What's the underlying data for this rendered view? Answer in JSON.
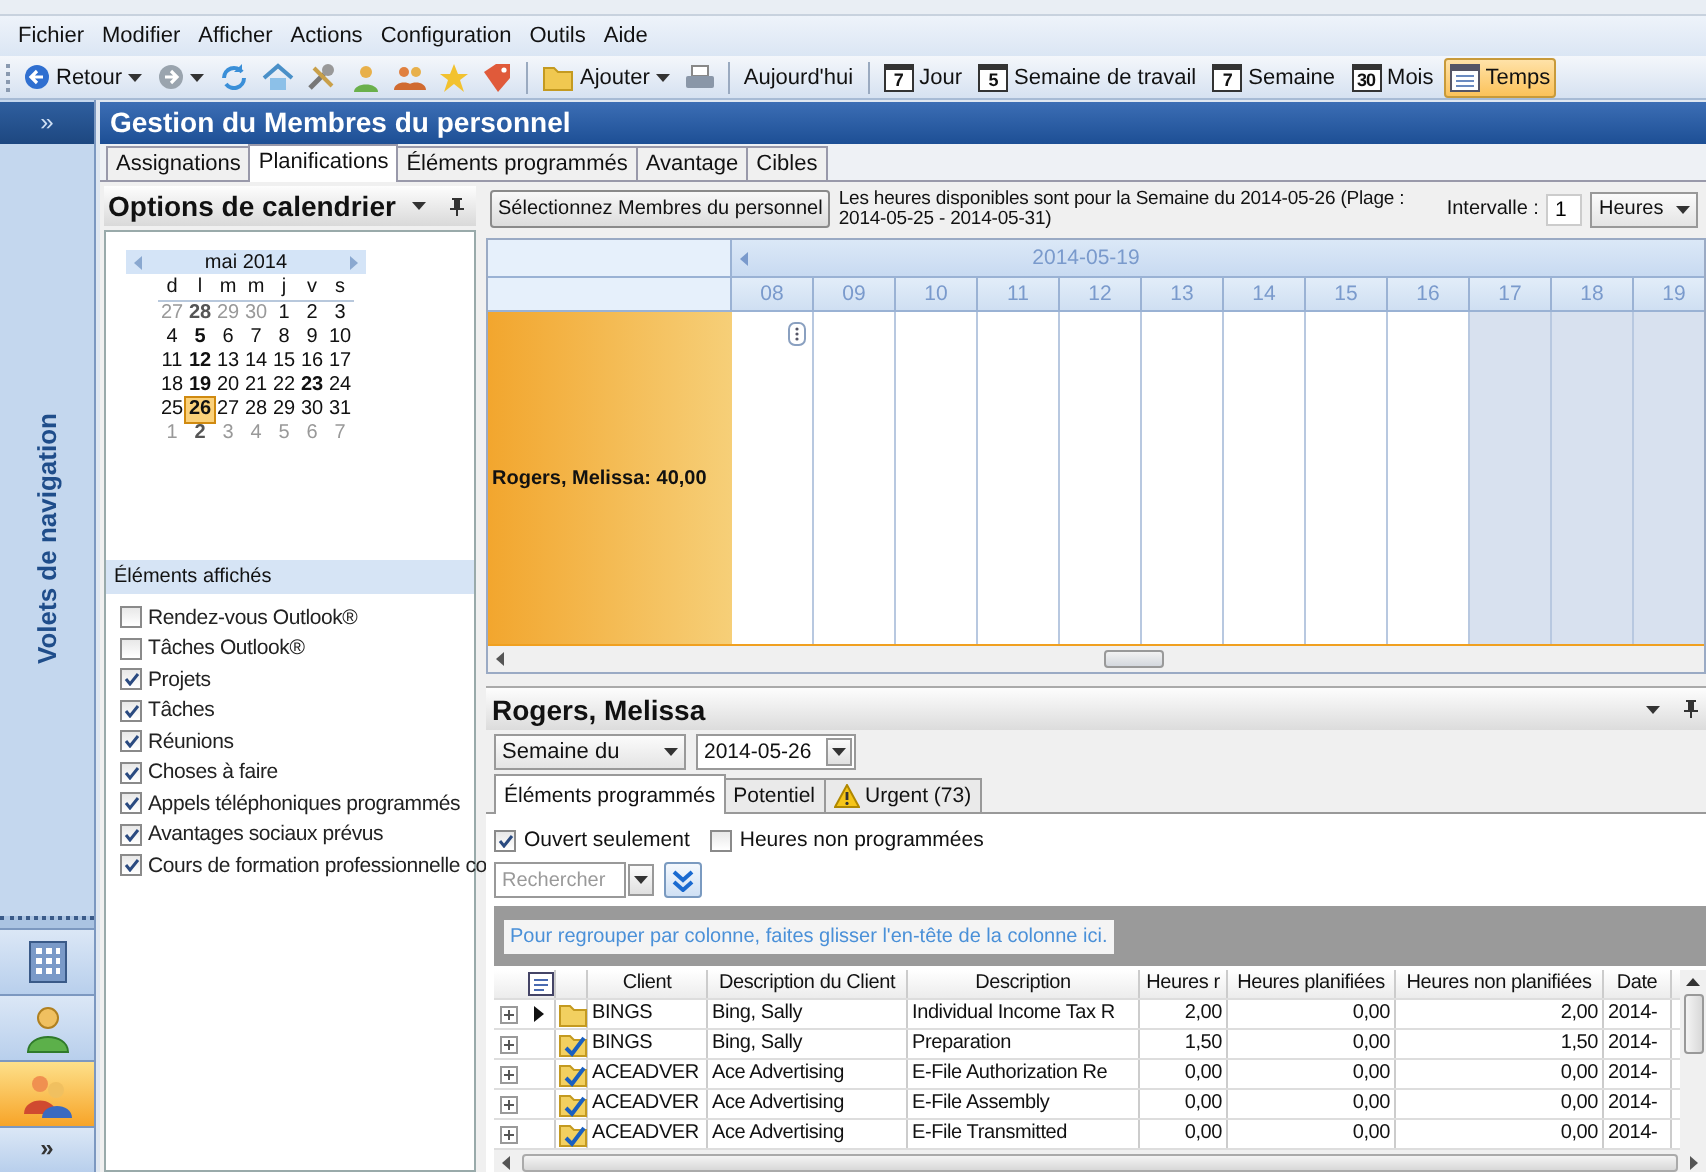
{
  "menu": [
    "Fichier",
    "Modifier",
    "Afficher",
    "Actions",
    "Configuration",
    "Outils",
    "Aide"
  ],
  "toolbar": {
    "back_label": "Retour",
    "add_label": "Ajouter",
    "today_label": "Aujourd'hui",
    "views": [
      {
        "number": "7",
        "label": "Jour",
        "selected": false
      },
      {
        "number": "5",
        "label": "Semaine de travail",
        "selected": false
      },
      {
        "number": "7",
        "label": "Semaine",
        "selected": false
      },
      {
        "number": "30",
        "label": "Mois",
        "selected": false
      },
      {
        "label": "Temps",
        "selected": true
      }
    ]
  },
  "nav": {
    "expand_glyph": "»",
    "title": "Volets de navigation",
    "bottom_glyph": "»",
    "buttons": [
      {
        "selected": false
      },
      {
        "selected": false
      },
      {
        "selected": true
      }
    ]
  },
  "window": {
    "title": "Gestion du Membres du personnel"
  },
  "tabs": [
    {
      "label": "Assignations",
      "selected": false
    },
    {
      "label": "Planifications",
      "selected": true
    },
    {
      "label": "Éléments programmés",
      "selected": false
    },
    {
      "label": "Avantage",
      "selected": false
    },
    {
      "label": "Cibles",
      "selected": false
    }
  ],
  "calendar_options": {
    "title": "Options de calendrier",
    "month": "mai 2014",
    "weekdays": [
      "d",
      "l",
      "m",
      "m",
      "j",
      "v",
      "s"
    ],
    "weeks": [
      [
        {
          "day": "27",
          "other_month": true,
          "bold": false,
          "selected": false
        },
        {
          "day": "28",
          "other_month": true,
          "bold": true,
          "selected": false
        },
        {
          "day": "29",
          "other_month": true,
          "bold": false,
          "selected": false
        },
        {
          "day": "30",
          "other_month": true,
          "bold": false,
          "selected": false
        },
        {
          "day": "1",
          "other_month": false,
          "bold": false,
          "selected": false
        },
        {
          "day": "2",
          "other_month": false,
          "bold": false,
          "selected": false
        },
        {
          "day": "3",
          "other_month": false,
          "bold": false,
          "selected": false
        }
      ],
      [
        {
          "day": "4",
          "other_month": false,
          "bold": false,
          "selected": false
        },
        {
          "day": "5",
          "other_month": false,
          "bold": true,
          "selected": false
        },
        {
          "day": "6",
          "other_month": false,
          "bold": false,
          "selected": false
        },
        {
          "day": "7",
          "other_month": false,
          "bold": false,
          "selected": false
        },
        {
          "day": "8",
          "other_month": false,
          "bold": false,
          "selected": false
        },
        {
          "day": "9",
          "other_month": false,
          "bold": false,
          "selected": false
        },
        {
          "day": "10",
          "other_month": false,
          "bold": false,
          "selected": false
        }
      ],
      [
        {
          "day": "11",
          "other_month": false,
          "bold": false,
          "selected": false
        },
        {
          "day": "12",
          "other_month": false,
          "bold": true,
          "selected": false
        },
        {
          "day": "13",
          "other_month": false,
          "bold": false,
          "selected": false
        },
        {
          "day": "14",
          "other_month": false,
          "bold": false,
          "selected": false
        },
        {
          "day": "15",
          "other_month": false,
          "bold": false,
          "selected": false
        },
        {
          "day": "16",
          "other_month": false,
          "bold": false,
          "selected": false
        },
        {
          "day": "17",
          "other_month": false,
          "bold": false,
          "selected": false
        }
      ],
      [
        {
          "day": "18",
          "other_month": false,
          "bold": false,
          "selected": false
        },
        {
          "day": "19",
          "other_month": false,
          "bold": true,
          "selected": false
        },
        {
          "day": "20",
          "other_month": false,
          "bold": false,
          "selected": false
        },
        {
          "day": "21",
          "other_month": false,
          "bold": false,
          "selected": false
        },
        {
          "day": "22",
          "other_month": false,
          "bold": false,
          "selected": false
        },
        {
          "day": "23",
          "other_month": false,
          "bold": true,
          "selected": false
        },
        {
          "day": "24",
          "other_month": false,
          "bold": false,
          "selected": false
        }
      ],
      [
        {
          "day": "25",
          "other_month": false,
          "bold": false,
          "selected": false
        },
        {
          "day": "26",
          "other_month": false,
          "bold": true,
          "selected": true
        },
        {
          "day": "27",
          "other_month": false,
          "bold": false,
          "selected": false
        },
        {
          "day": "28",
          "other_month": false,
          "bold": false,
          "selected": false
        },
        {
          "day": "29",
          "other_month": false,
          "bold": false,
          "selected": false
        },
        {
          "day": "30",
          "other_month": false,
          "bold": false,
          "selected": false
        },
        {
          "day": "31",
          "other_month": false,
          "bold": false,
          "selected": false
        }
      ],
      [
        {
          "day": "1",
          "other_month": true,
          "bold": false,
          "selected": false
        },
        {
          "day": "2",
          "other_month": true,
          "bold": true,
          "selected": false
        },
        {
          "day": "3",
          "other_month": true,
          "bold": false,
          "selected": false
        },
        {
          "day": "4",
          "other_month": true,
          "bold": false,
          "selected": false
        },
        {
          "day": "5",
          "other_month": true,
          "bold": false,
          "selected": false
        },
        {
          "day": "6",
          "other_month": true,
          "bold": false,
          "selected": false
        },
        {
          "day": "7",
          "other_month": true,
          "bold": false,
          "selected": false
        }
      ]
    ],
    "shown_title": "Éléments affichés",
    "shown_items": [
      {
        "label": "Rendez-vous Outlook®",
        "checked": false
      },
      {
        "label": "Tâches Outlook®",
        "checked": false
      },
      {
        "label": "Projets",
        "checked": true
      },
      {
        "label": "Tâches",
        "checked": true
      },
      {
        "label": "Réunions",
        "checked": true
      },
      {
        "label": "Choses à faire",
        "checked": true
      },
      {
        "label": "Appels téléphoniques programmés",
        "checked": true
      },
      {
        "label": "Avantages sociaux prévus",
        "checked": true
      },
      {
        "label": "Cours de formation professionnelle co",
        "checked": true
      }
    ]
  },
  "schedule": {
    "select_button": "Sélectionnez Membres du personnel",
    "info": "Les heures disponibles sont pour la Semaine du 2014-05-26 (Plage : 2014-05-25 - 2014-05-31)",
    "interval_label": "Intervalle :",
    "interval_value": "1",
    "unit": "Heures",
    "date": "2014-05-19",
    "hours": [
      {
        "label": "08",
        "off": false
      },
      {
        "label": "09",
        "off": false
      },
      {
        "label": "10",
        "off": false
      },
      {
        "label": "11",
        "off": false
      },
      {
        "label": "12",
        "off": false
      },
      {
        "label": "13",
        "off": false
      },
      {
        "label": "14",
        "off": false
      },
      {
        "label": "15",
        "off": false
      },
      {
        "label": "16",
        "off": false
      },
      {
        "label": "17",
        "off": true
      },
      {
        "label": "18",
        "off": true
      },
      {
        "label": "19",
        "off": true
      }
    ],
    "resource": "Rogers, Melissa: 40,00"
  },
  "detail": {
    "title": "Rogers, Melissa",
    "period": "Semaine du",
    "date": "2014-05-26",
    "tabs": [
      {
        "label": "Éléments programmés",
        "selected": true,
        "kind": "plain"
      },
      {
        "label": "Potentiel",
        "selected": false,
        "kind": "plain"
      },
      {
        "label": "Urgent (73)",
        "selected": false,
        "kind": "warning"
      }
    ],
    "filters": [
      {
        "label": "Ouvert seulement",
        "checked": true
      },
      {
        "label": "Heures non programmées",
        "checked": false
      }
    ],
    "search_placeholder": "Rechercher",
    "group_hint": "Pour regrouper par colonne, faites glisser l'en-tête de la colonne ici.",
    "columns": [
      "Client",
      "Description du Client",
      "Description",
      "Heures r",
      "Heures planifiées",
      "Heures non planifiées",
      "Date"
    ],
    "rows": [
      {
        "cells": [
          "BINGS",
          "Bing, Sally",
          "Individual Income Tax R",
          "2,00",
          "0,00",
          "2,00",
          "2014-"
        ],
        "current": true,
        "ticked": false
      },
      {
        "cells": [
          "BINGS",
          "Bing, Sally",
          "Preparation",
          "1,50",
          "0,00",
          "1,50",
          "2014-"
        ],
        "current": false,
        "ticked": true
      },
      {
        "cells": [
          "ACEADVER",
          "Ace Advertising",
          "E-File Authorization Re",
          "0,00",
          "0,00",
          "0,00",
          "2014-"
        ],
        "current": false,
        "ticked": true
      },
      {
        "cells": [
          "ACEADVER",
          "Ace Advertising",
          "E-File Assembly",
          "0,00",
          "0,00",
          "0,00",
          "2014-"
        ],
        "current": false,
        "ticked": true
      },
      {
        "cells": [
          "ACEADVER",
          "Ace Advertising",
          "E-File Transmitted",
          "0,00",
          "0,00",
          "0,00",
          "2014-"
        ],
        "current": false,
        "ticked": true
      }
    ]
  }
}
